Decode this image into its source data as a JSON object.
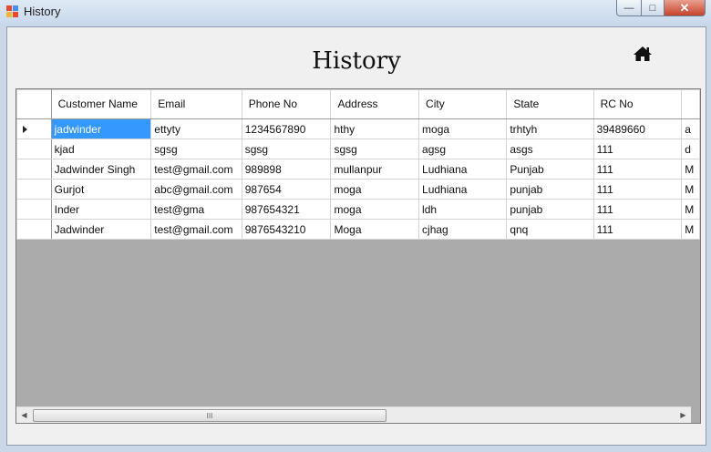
{
  "window": {
    "title": "History",
    "minimize": "—",
    "maximize": "□",
    "close": "✕"
  },
  "page": {
    "heading": "History",
    "home_icon": "home-icon"
  },
  "grid": {
    "columns": [
      "Customer Name",
      "Email",
      "Phone No",
      "Address",
      "City",
      "State",
      "RC No"
    ],
    "rows": [
      [
        "jadwinder",
        "ettyty",
        "1234567890",
        "hthy",
        "moga",
        "trhtyh",
        "39489660",
        "a"
      ],
      [
        "kjad",
        "sgsg",
        "sgsg",
        "sgsg",
        "agsg",
        "asgs",
        "111",
        "d"
      ],
      [
        "Jadwinder Singh",
        "test@gmail.com",
        "989898",
        "mullanpur",
        "Ludhiana",
        "Punjab",
        "111",
        "M"
      ],
      [
        "Gurjot",
        "abc@gmail.com",
        "987654",
        "moga",
        "Ludhiana",
        "punjab",
        "111",
        "M"
      ],
      [
        "Inder",
        "test@gma",
        "987654321",
        "moga",
        "ldh",
        "punjab",
        "111",
        "M"
      ],
      [
        "Jadwinder",
        "test@gmail.com",
        "9876543210",
        "Moga",
        "cjhag",
        "qnq",
        "111",
        "M"
      ]
    ],
    "selected_row": 0,
    "selected_cell_text": "jadwinder",
    "scroll_thumb_grip": "III",
    "scroll_left": "◀",
    "scroll_right": "▶"
  }
}
